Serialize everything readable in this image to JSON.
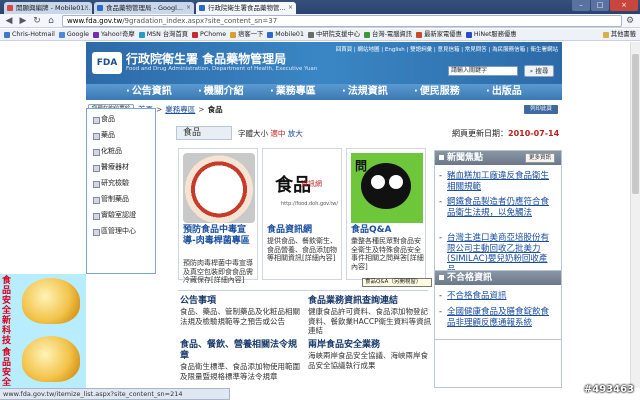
{
  "browser": {
    "tabs": [
      {
        "label": "開顯興編牌 - Mobile01..."
      },
      {
        "label": "食品藥物管理局 - Googl..."
      },
      {
        "label": "行政院衛生署食品藥物管..."
      }
    ],
    "url_prefix": "www.fda.gov.tw",
    "url_path": "/9gradation_index.aspx?site_content_sn=37",
    "bookmarks": [
      {
        "label": "Chris-Hotmail",
        "color": "#3a7ac8"
      },
      {
        "label": "Google",
        "color": "#4a8ad8"
      },
      {
        "label": "Yahoo!奇摩",
        "color": "#7a2ab8"
      },
      {
        "label": "MSN 台灣首頁",
        "color": "#2a9ac8"
      },
      {
        "label": "PChome",
        "color": "#c82a2a"
      },
      {
        "label": "痞客一下",
        "color": "#d8a02a"
      },
      {
        "label": "Mobile01",
        "color": "#2a6ac8"
      },
      {
        "label": "中研院支援中心",
        "color": "#6a6a6a"
      },
      {
        "label": "台灣-電腦資訊",
        "color": "#3a9a3a"
      },
      {
        "label": "最新家電優惠",
        "color": "#c84a2a"
      },
      {
        "label": "HiNet服務優惠",
        "color": "#2a4ac8"
      }
    ],
    "bookmarks_more": "其他書籤",
    "status": "www.fda.gov.tw/itemize_list.aspx?site_content_sn=214"
  },
  "header": {
    "logo": "FDA",
    "title": "行政院衛生署  食品藥物管理局",
    "subtitle": "Food and Drug Administration, Department of Health, Executive Yuan",
    "toplinks": "回首頁 | 網站地圖 | English | 雙語詞彙 | 意見信箱 | 常見問答 | 為民服務信箱 | 衛生署網站",
    "search_placeholder": "請輸入關鍵字",
    "search_button": "搜尋"
  },
  "mainnav": [
    "公告資訊",
    "機關介紹",
    "業務專區",
    "法規資訊",
    "便民服務",
    "出版品"
  ],
  "breadcrumb": {
    "button": "您現在的位置於",
    "home": "首頁",
    "section": "業務專區",
    "current": "食品",
    "print": "列印此頁"
  },
  "sidenav": [
    "食品",
    "藥品",
    "化粧品",
    "醫療器材",
    "研究檢驗",
    "管制藥品",
    "實驗室認證",
    "區管理中心"
  ],
  "promo": {
    "text1": "食品安全",
    "text2": "新科技",
    "text3": "食品安全"
  },
  "section": {
    "label": "食品",
    "fontsize_label": "字體大小",
    "fontsize_options": [
      "適中",
      "放大"
    ],
    "updated_label": "網頁更新日期：",
    "updated_date": "2010-07-14"
  },
  "cards": [
    {
      "title": "預防食品中毒宣導-肉毒桿菌專區",
      "desc": "預防肉毒桿菌中毒宣導及真空包裝即食食品需冷藏保存[詳細內容]"
    },
    {
      "title": "食品資訊網",
      "desc": "提供食品、餐飲衛生、食品營養、食品添加物等相關資訊[詳細內容]",
      "logo": "食品",
      "logo_small": "資訊網",
      "logo_url": "http://food.doh.gov.tw/"
    },
    {
      "title": "食品Q&A",
      "desc": "彙整各種民眾對食品安全衛生及特殊食品安全事件相關之問與答[詳細內容]",
      "tooltip": "食品Q&A（另開視窗）",
      "badge": "問"
    }
  ],
  "news": {
    "title": "新聞焦點",
    "more": "更多資訊",
    "items": [
      "豬血糕加工廠違反食品衛生相關規範",
      "鋼鐵食品製造者仍應符合食品衛生法規，以免觸法",
      "台灣主進口美商亞培股份有限公司主動回收乙批美力(SIMILAC)嬰兒奶粉回收產品"
    ]
  },
  "bad": {
    "title": "不合格資訊",
    "items": [
      "不合格食品資訊",
      "全國健康食品及膳食錠飲食品非理顧反應通報系統"
    ]
  },
  "info": [
    {
      "title": "公告事項",
      "desc": "食品、藥品、管制藥品及化粧品相關法規及檢驗規範等之預告或公告"
    },
    {
      "title": "食品業務資訊查詢連結",
      "desc": "健康食品許可資料、食品添加物登記資料、餐飲業HACCP衛生資料等資訊連結"
    },
    {
      "title": "食品、餐飲、營養相關法令規章",
      "desc": "食品衛生標準、食品添加物使用範圍及限量暨規格標準等法令規章"
    },
    {
      "title": "兩岸食品安全業務",
      "desc": "海峽兩岸食品安全協議、海峽兩岸食品安全協議執行成果"
    }
  ],
  "watermark": "#493463"
}
